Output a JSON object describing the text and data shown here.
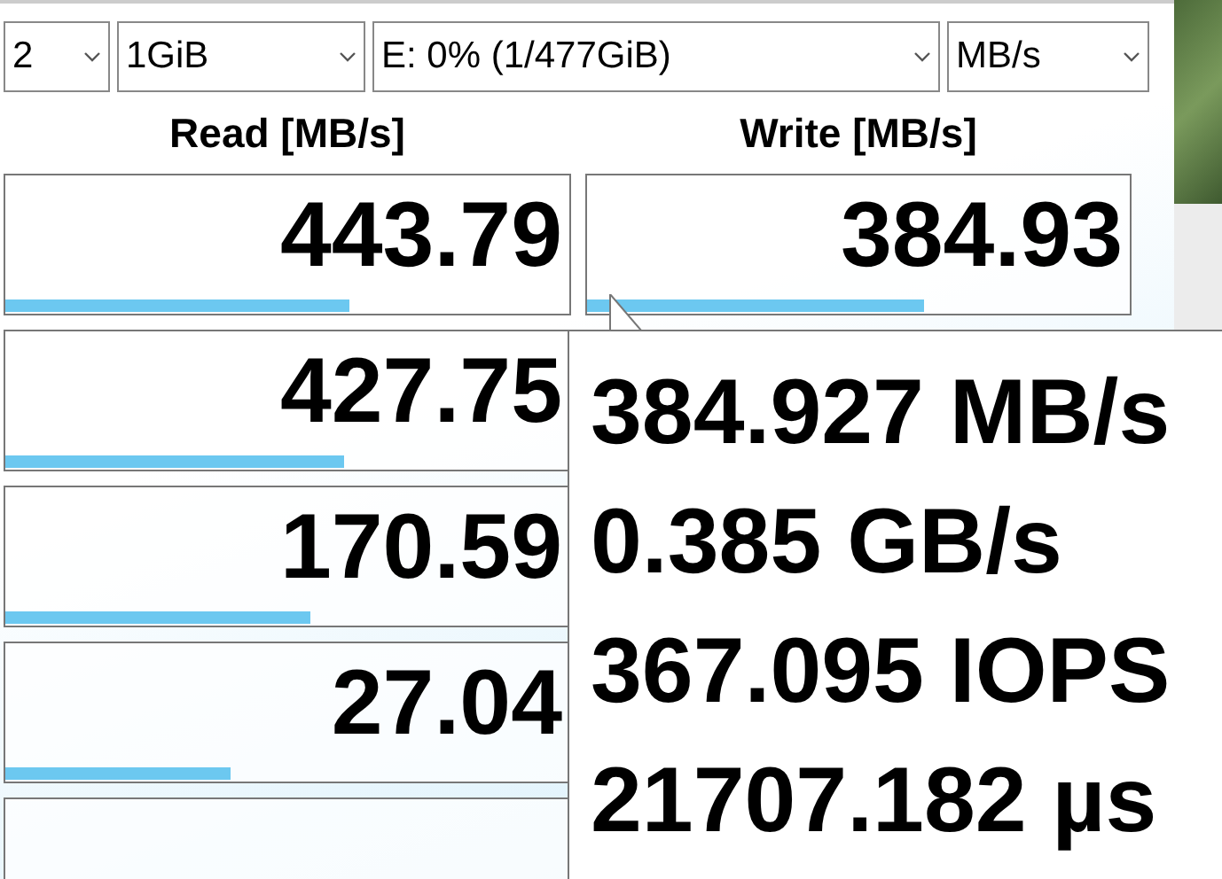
{
  "settings": [
    {
      "value": "2"
    },
    {
      "value": "1GiB"
    },
    {
      "value": "E: 0% (1/477GiB)"
    },
    {
      "value": "MB/s"
    }
  ],
  "headers": {
    "read": "Read [MB/s]",
    "write": "Write [MB/s]"
  },
  "results": [
    {
      "read": {
        "value": "443.79",
        "level": 0.61
      },
      "write": {
        "value": "384.93",
        "level": 0.62
      }
    },
    {
      "read": {
        "value": "427.75",
        "level": 0.6
      }
    },
    {
      "read": {
        "value": "170.59",
        "level": 0.54
      }
    },
    {
      "read": {
        "value": "27.04",
        "level": 0.4
      }
    }
  ],
  "tooltip": {
    "lines": [
      "384.927 MB/s",
      "0.385 GB/s",
      "367.095 IOPS",
      "21707.182 µs"
    ]
  }
}
